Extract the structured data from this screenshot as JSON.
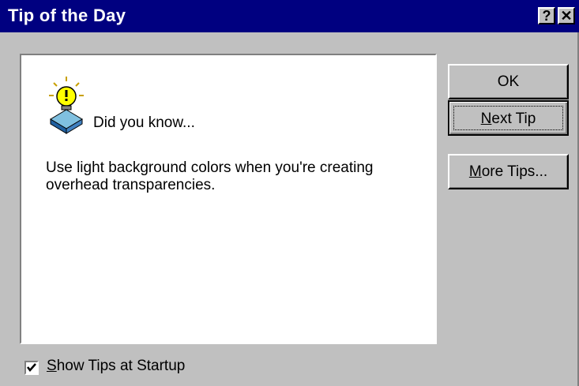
{
  "window": {
    "title": "Tip of the Day",
    "help_glyph": "?",
    "close_glyph": "✕"
  },
  "tip": {
    "header": "Did you know...",
    "text": "Use light background colors when you're creating overhead transparencies.",
    "icon": "lightbulb-icon"
  },
  "buttons": {
    "ok": "OK",
    "next_tip_prefix": "",
    "next_tip_mnemonic": "N",
    "next_tip_rest": "ext Tip",
    "more_tips_mnemonic": "M",
    "more_tips_rest": "ore Tips..."
  },
  "startup": {
    "checked": true,
    "label_mnemonic": "S",
    "label_rest": "how Tips at Startup"
  },
  "colors": {
    "titlebar": "#000080",
    "face": "#c0c0c0",
    "bulb": "#ffff00"
  }
}
